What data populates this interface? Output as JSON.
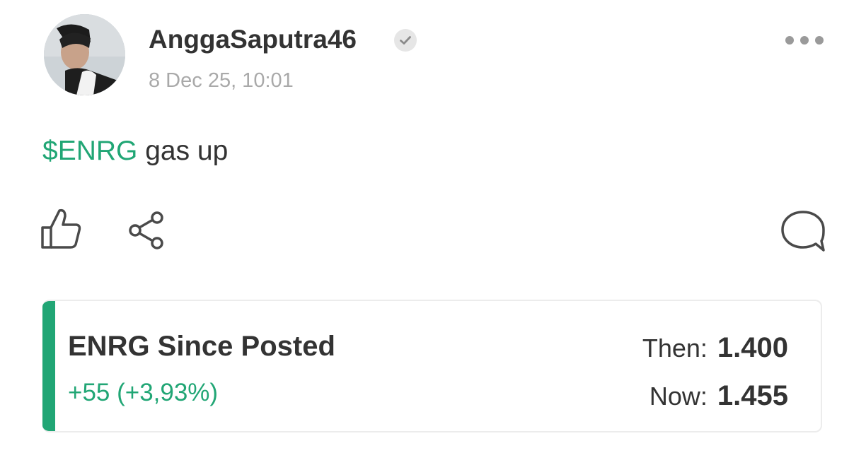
{
  "post": {
    "username": "AnggaSaputra46",
    "timestamp": "8 Dec 25, 10:01",
    "cashtag": "$ENRG",
    "text": " gas up"
  },
  "icons": {
    "verified": "verified-check-icon",
    "more": "more-dots-icon",
    "like": "thumbs-up-icon",
    "share": "share-icon",
    "comment": "comment-bubble-icon"
  },
  "since_posted": {
    "title": "ENRG Since Posted",
    "change": "+55 (+3,93%)",
    "then_label": "Then:",
    "then_value": "1.400",
    "now_label": "Now:",
    "now_value": "1.455"
  },
  "colors": {
    "accent_green": "#21a675",
    "text_primary": "#333333",
    "text_muted": "#a9a9a9"
  }
}
